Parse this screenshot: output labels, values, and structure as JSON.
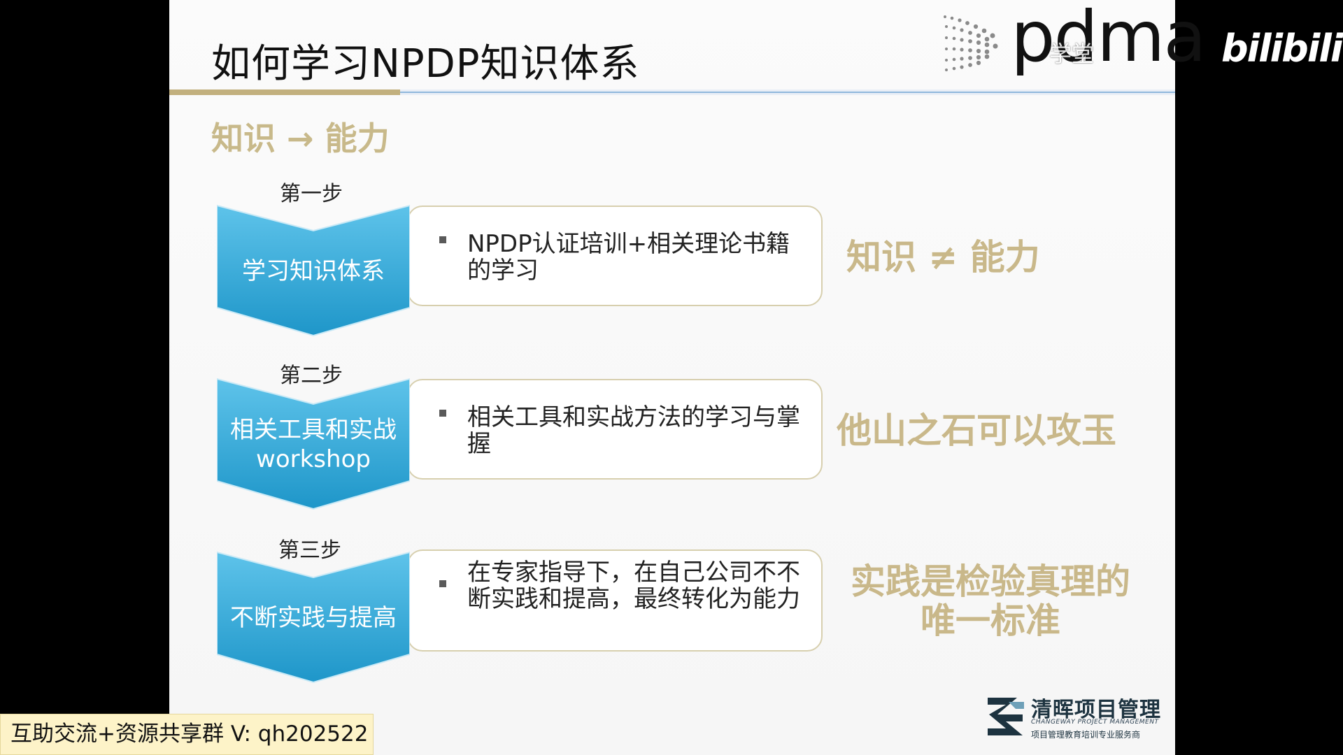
{
  "slide": {
    "title": "如何学习NPDP知识体系",
    "subheading": "知识 → 能力"
  },
  "brand": {
    "pdma": "pdma",
    "school_text": "学堂",
    "bilibili": "bilibili",
    "qinghui_name": "清晖项目管理",
    "qinghui_en": "CHANGEWAY PROJECT MANAGEMENT",
    "qinghui_tag": "项目管理教育培训专业服务商"
  },
  "steps": [
    {
      "step_label": "第一步",
      "chevron": "学习知识体系",
      "bullet": "NPDP认证培训+相关理论书籍的学习",
      "remark": "知识 ≠ 能力"
    },
    {
      "step_label": "第二步",
      "chevron": "相关工具和实战workshop",
      "bullet": "相关工具和实战方法的学习与掌握",
      "remark": "他山之石可以攻玉"
    },
    {
      "step_label": "第三步",
      "chevron": "不断实践与提高",
      "bullet": "在专家指导下，在自己公司不不断实践和提高，最终转化为能力",
      "remark": "实践是检验真理的唯一标准"
    }
  ],
  "overlay": {
    "group_banner": "互助交流+资源共享群 V: qh202522"
  },
  "colors": {
    "chevron_top": "#5ec3ea",
    "chevron_bottom": "#1e96c9",
    "accent_gold": "#c9b88a",
    "card_border": "#d7cfae"
  }
}
